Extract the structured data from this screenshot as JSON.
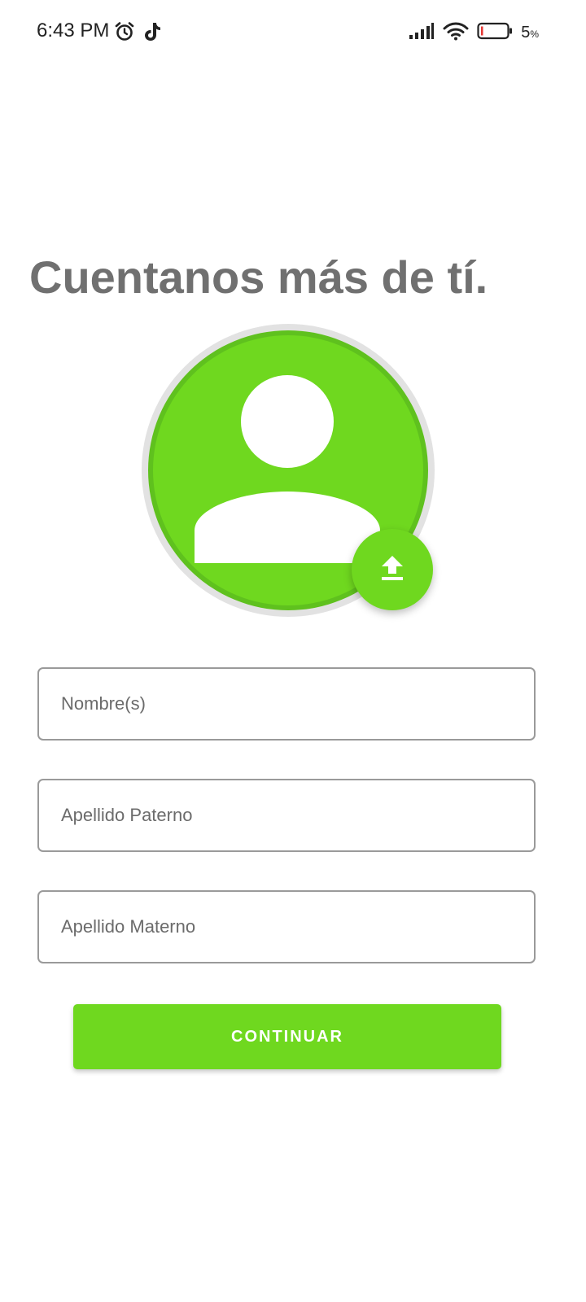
{
  "status_bar": {
    "time": "6:43 PM",
    "battery_percent": "5",
    "battery_unit": "%",
    "icons": [
      "alarm-icon",
      "tiktok-icon",
      "signal-icon",
      "wifi-icon",
      "battery-icon"
    ]
  },
  "page": {
    "title": "Cuentanos más de tí."
  },
  "avatar": {
    "icon": "user-silhouette-icon",
    "upload_icon": "upload-icon"
  },
  "form": {
    "first_name": {
      "placeholder": "Nombre(s)",
      "value": ""
    },
    "paternal_last_name": {
      "placeholder": "Apellido Paterno",
      "value": ""
    },
    "maternal_last_name": {
      "placeholder": "Apellido Materno",
      "value": ""
    }
  },
  "actions": {
    "continue_label": "CONTINUAR"
  },
  "colors": {
    "accent": "#6fd81f",
    "accent_dark": "#5fc11e",
    "title": "#707070",
    "field_border": "#9a9a9a"
  }
}
